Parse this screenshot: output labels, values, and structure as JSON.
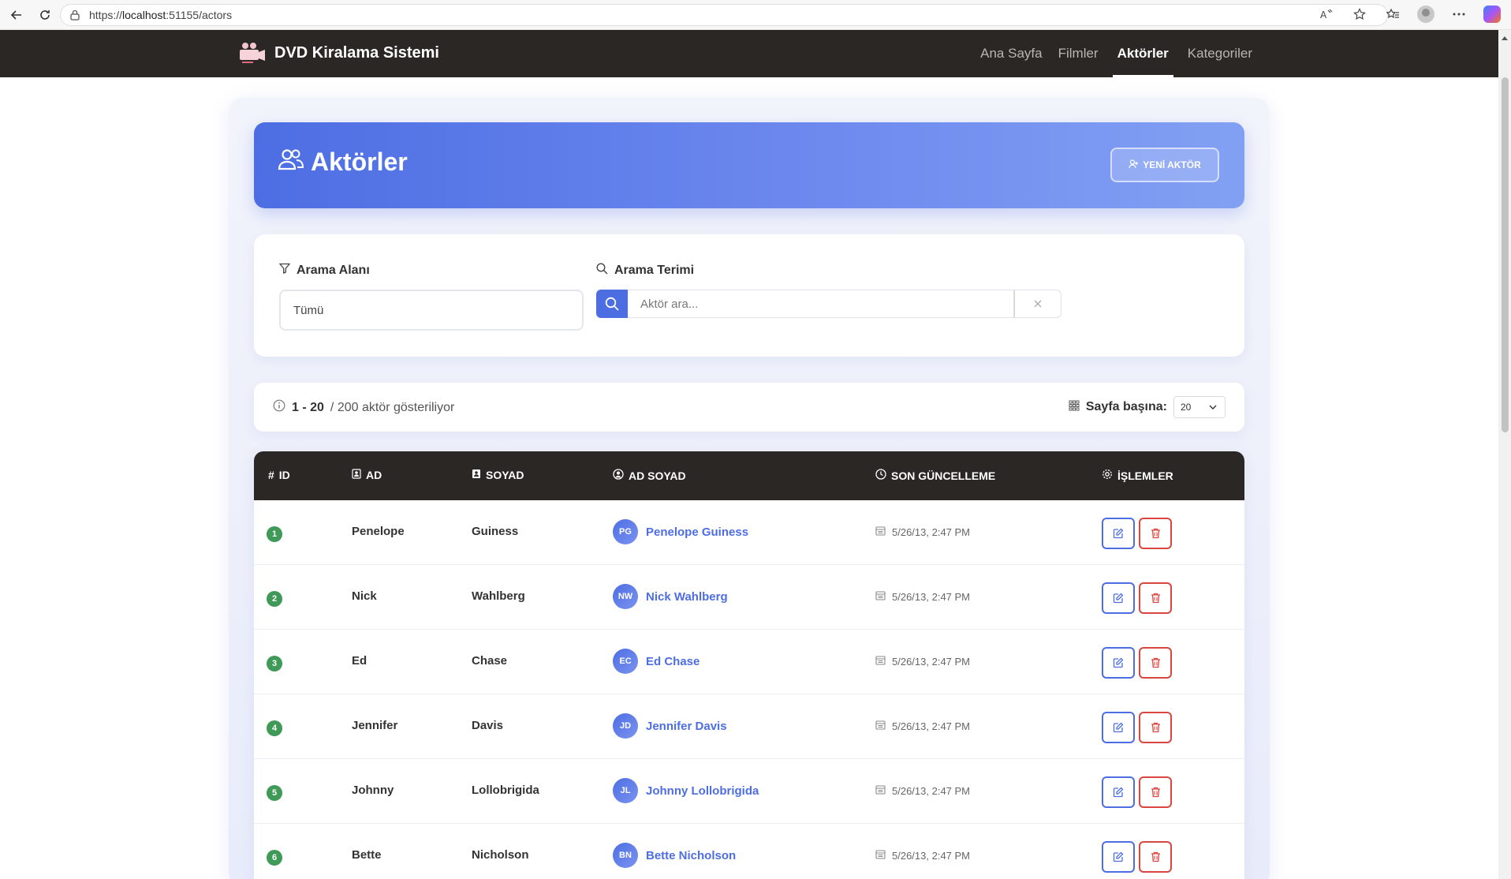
{
  "browser": {
    "url_prefix": "https://",
    "url_host": "localhost",
    "url_rest": ":51155/actors"
  },
  "navbar": {
    "brand": "DVD Kiralama Sistemi",
    "links": [
      "Ana Sayfa",
      "Filmler",
      "Aktörler",
      "Kategoriler"
    ],
    "active_index": 2
  },
  "hero": {
    "title": "Aktörler",
    "new_button": "YENİ AKTÖR"
  },
  "search": {
    "field_label": "Arama Alanı",
    "field_value": "Tümü",
    "term_label": "Arama Terimi",
    "term_placeholder": "Aktör ara..."
  },
  "info": {
    "range": "1 - 20",
    "rest": "/ 200 aktör gösteriliyor",
    "per_page_label": "Sayfa başına:",
    "per_page_value": "20"
  },
  "table": {
    "headers": {
      "id": "ID",
      "first": "AD",
      "last": "SOYAD",
      "full": "AD SOYAD",
      "updated": "SON GÜNCELLEME",
      "actions": "İŞLEMLER"
    },
    "rows": [
      {
        "id": "1",
        "first": "Penelope",
        "last": "Guiness",
        "initials": "PG",
        "full": "Penelope Guiness",
        "updated": "5/26/13, 2:47 PM"
      },
      {
        "id": "2",
        "first": "Nick",
        "last": "Wahlberg",
        "initials": "NW",
        "full": "Nick Wahlberg",
        "updated": "5/26/13, 2:47 PM"
      },
      {
        "id": "3",
        "first": "Ed",
        "last": "Chase",
        "initials": "EC",
        "full": "Ed Chase",
        "updated": "5/26/13, 2:47 PM"
      },
      {
        "id": "4",
        "first": "Jennifer",
        "last": "Davis",
        "initials": "JD",
        "full": "Jennifer Davis",
        "updated": "5/26/13, 2:47 PM"
      },
      {
        "id": "5",
        "first": "Johnny",
        "last": "Lollobrigida",
        "initials": "JL",
        "full": "Johnny Lollobrigida",
        "updated": "5/26/13, 2:47 PM"
      },
      {
        "id": "6",
        "first": "Bette",
        "last": "Nicholson",
        "initials": "BN",
        "full": "Bette Nicholson",
        "updated": "5/26/13, 2:47 PM"
      }
    ]
  },
  "colors": {
    "accent": "#4d6ee3",
    "danger": "#d9463f",
    "success": "#3f9a57",
    "dark": "#2b2725"
  }
}
